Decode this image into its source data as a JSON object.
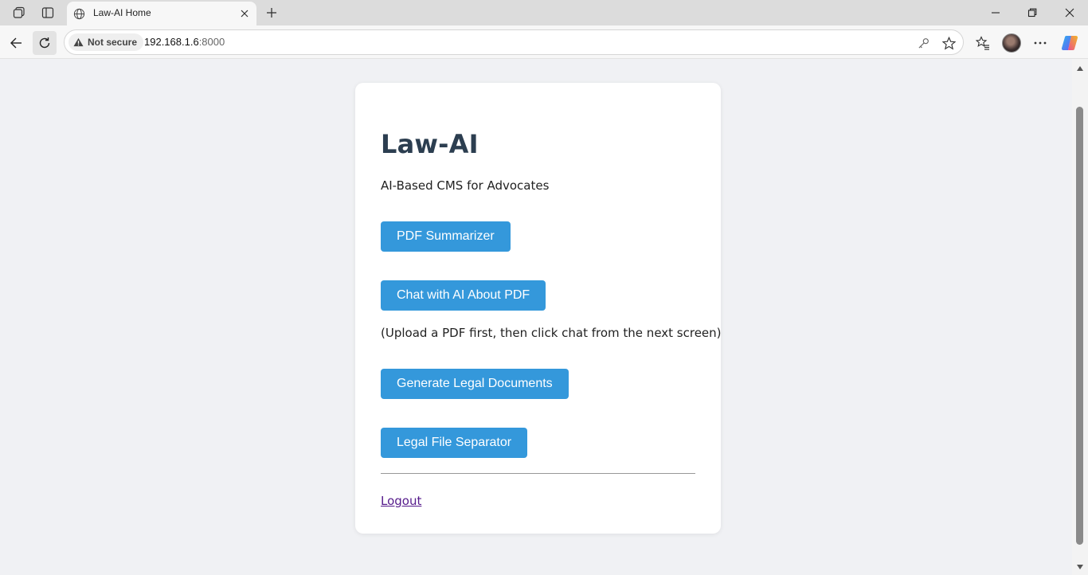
{
  "browser": {
    "tab": {
      "title": "Law-AI Home"
    },
    "address_bar": {
      "security_label": "Not secure",
      "url_host": "192.168.1.6",
      "url_port": ":8000"
    }
  },
  "page": {
    "app_title": "Law-AI",
    "subtitle": "AI-Based CMS for Advocates",
    "buttons": {
      "pdf_summarizer": "PDF Summarizer",
      "chat_pdf": "Chat with AI About PDF",
      "generate_docs": "Generate Legal Documents",
      "file_separator": "Legal File Separator"
    },
    "chat_note": "(Upload a PDF first, then click chat from the next screen)",
    "logout_label": "Logout"
  },
  "colors": {
    "accent_button": "#3498db",
    "title_text": "#2c3e50",
    "visited_link": "#551a8b",
    "page_background": "#f0f1f4"
  },
  "icons": [
    "workspaces-icon",
    "tab-actions-icon",
    "globe-icon",
    "close-icon",
    "plus-icon",
    "minimize-icon",
    "restore-icon",
    "window-close-icon",
    "back-arrow-icon",
    "refresh-icon",
    "warning-icon",
    "key-icon",
    "star-icon",
    "favorites-icon",
    "more-icon",
    "copilot-icon"
  ]
}
